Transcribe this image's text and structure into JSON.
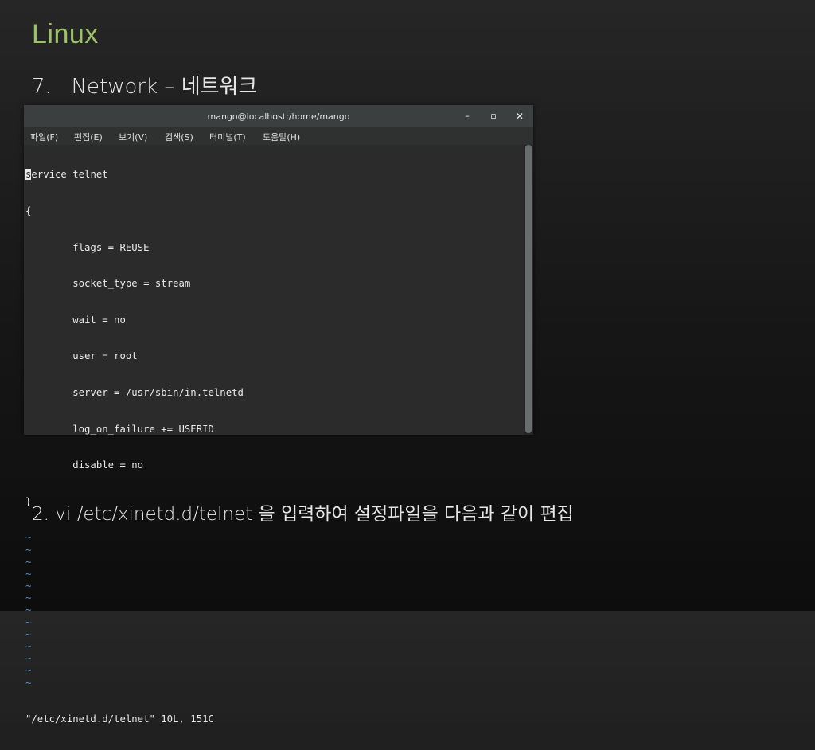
{
  "slide": {
    "title": "Linux",
    "subtitle": "7.   Network – 네트워크",
    "caption": "2. vi /etc/xinetd.d/telnet 을 입력하여 설정파일을 다음과 같이 편집"
  },
  "terminal": {
    "window_title": "mango@localhost:/home/mango",
    "controls": {
      "minimize": "–",
      "maximize": "▫",
      "close": "✕"
    },
    "menu": [
      "파일(F)",
      "편집(E)",
      "보기(V)",
      "검색(S)",
      "터미널(T)",
      "도움말(H)"
    ],
    "cursor_char": "s",
    "first_line_rest": "ervice telnet",
    "lines": [
      "{",
      "        flags = REUSE",
      "        socket_type = stream",
      "        wait = no",
      "        user = root",
      "        server = /usr/sbin/in.telnetd",
      "        log_on_failure += USERID",
      "        disable = no",
      "}"
    ],
    "tilde": "~",
    "tilde_count": 13,
    "status_line": "\"/etc/xinetd.d/telnet\" 10L, 151C"
  },
  "colors": {
    "title_green": "#9bc26a",
    "tilde_blue": "#5f88c8"
  }
}
